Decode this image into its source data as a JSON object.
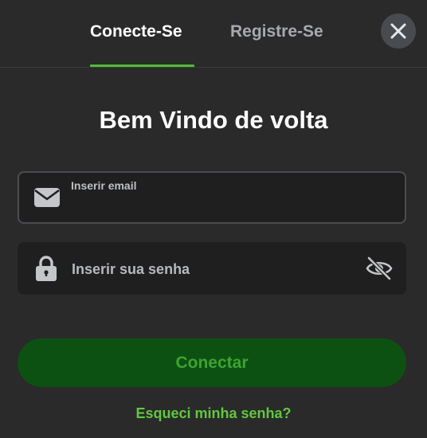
{
  "tabs": {
    "login_label": "Conecte-Se",
    "register_label": "Registre-Se",
    "active": "login"
  },
  "form": {
    "title": "Bem Vindo de volta",
    "email": {
      "label": "Inserir email",
      "value": "",
      "icon": "envelope-icon"
    },
    "password": {
      "placeholder": "Inserir sua senha",
      "value": "",
      "icon": "lock-icon",
      "visibility_icon": "eye-off-icon"
    },
    "submit_label": "Conectar",
    "forgot_label": "Esqueci minha senha?"
  },
  "icons": {
    "close": "close-icon"
  },
  "colors": {
    "background": "#2a2a2a",
    "field_background": "#1f1f1f",
    "accent_green": "#4bc02f",
    "button_background": "#0d5112",
    "button_text": "#3da52b",
    "link_green": "#5fc93b",
    "close_button_background": "#484b50"
  }
}
